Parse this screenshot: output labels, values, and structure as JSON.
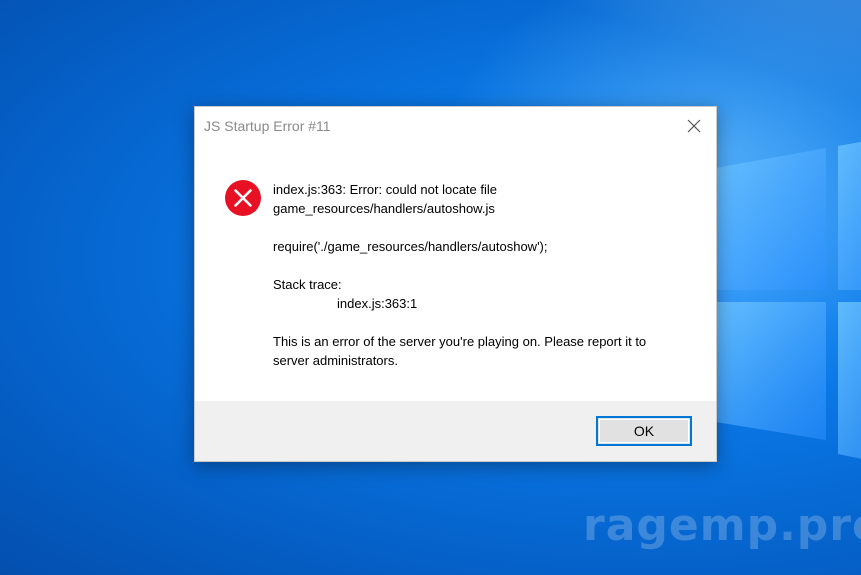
{
  "desktop": {
    "background": "#0a78e6",
    "watermark": "ragemp.pro"
  },
  "dialog": {
    "title": "JS Startup Error #11",
    "close_icon": "close-icon",
    "error_icon": "error-icon",
    "error_color": "#e81123",
    "message": {
      "line1": "index.js:363: Error: could not locate file",
      "line2": "game_resources/handlers/autoshow.js",
      "line3": "require('./game_resources/handlers/autoshow');",
      "stack_label": "Stack trace:",
      "stack_line": "index.js:363:1",
      "notice_line1": "This is an error of the server you're playing on. Please report it to",
      "notice_line2": "server administrators."
    },
    "ok_label": "OK",
    "accent": "#0078d7"
  }
}
